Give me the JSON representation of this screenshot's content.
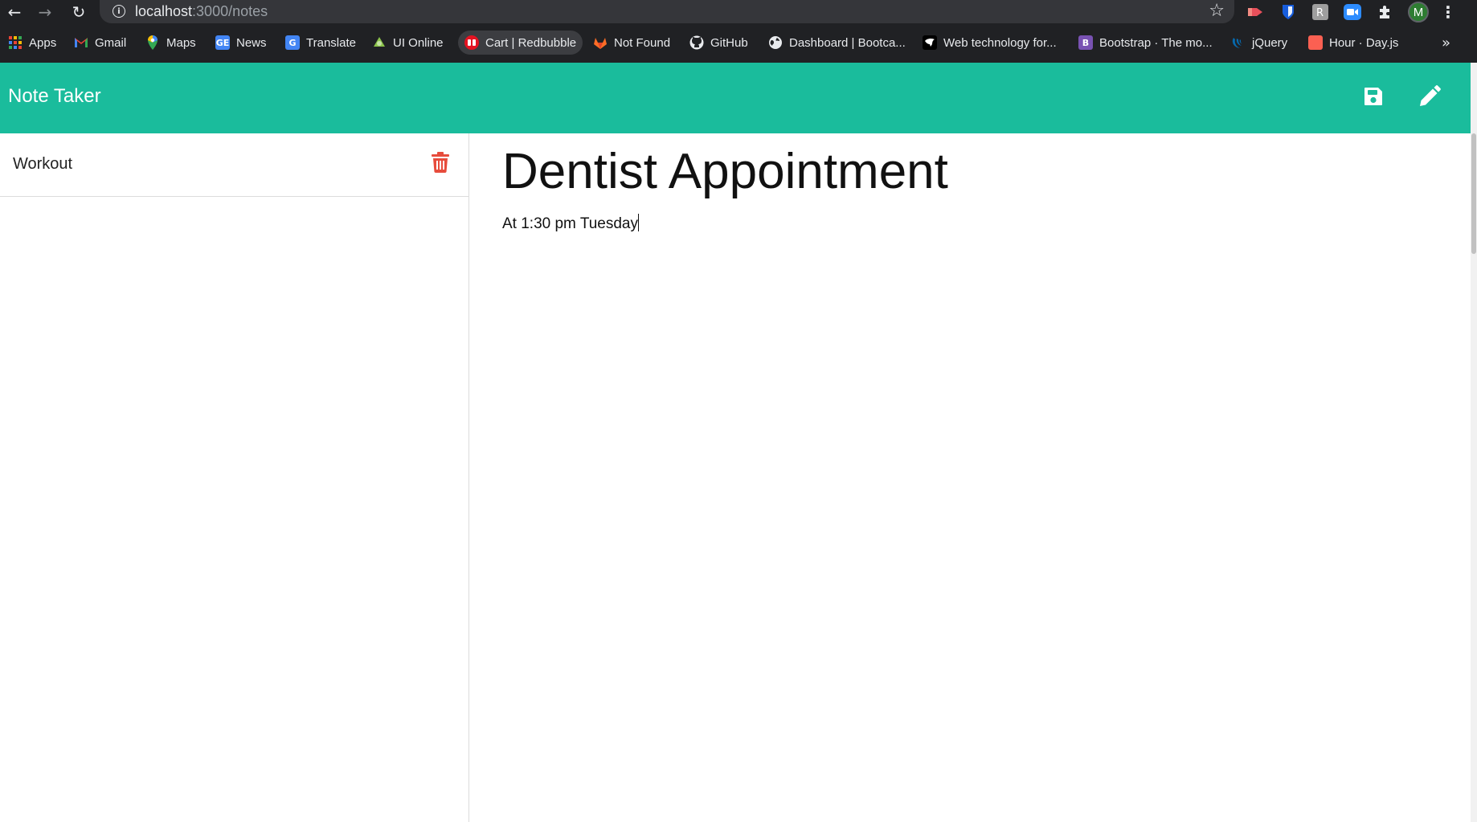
{
  "browser": {
    "url_host": "localhost",
    "url_path": ":3000/notes",
    "profile_initial": "M",
    "bookmarks": [
      {
        "label": "Apps",
        "icon": "apps-grid-icon"
      },
      {
        "label": "Gmail",
        "icon": "gmail-icon"
      },
      {
        "label": "Maps",
        "icon": "maps-pin-icon"
      },
      {
        "label": "News",
        "icon": "google-news-icon"
      },
      {
        "label": "Translate",
        "icon": "google-translate-icon"
      },
      {
        "label": "UI Online",
        "icon": "ui-online-icon"
      },
      {
        "label": "Cart | Redbubble",
        "icon": "redbubble-icon"
      },
      {
        "label": "Not Found",
        "icon": "gitlab-icon"
      },
      {
        "label": "GitHub",
        "icon": "github-icon"
      },
      {
        "label": "Dashboard | Bootca...",
        "icon": "globe-icon"
      },
      {
        "label": "Web technology for...",
        "icon": "mdn-icon"
      },
      {
        "label": "Bootstrap · The mo...",
        "icon": "bootstrap-icon"
      },
      {
        "label": "jQuery",
        "icon": "jquery-icon"
      },
      {
        "label": "Hour · Day.js",
        "icon": "dayjs-icon"
      }
    ]
  },
  "app": {
    "brand": "Note Taker",
    "accent_color": "#1abc9c",
    "delete_color": "#e74c3c",
    "toolbar": {
      "save_icon": "save-icon",
      "new_note_icon": "pencil-icon"
    },
    "notes": [
      {
        "title": "Workout"
      }
    ],
    "active_note": {
      "title": "Dentist Appointment",
      "body": "At 1:30 pm Tuesday"
    }
  }
}
